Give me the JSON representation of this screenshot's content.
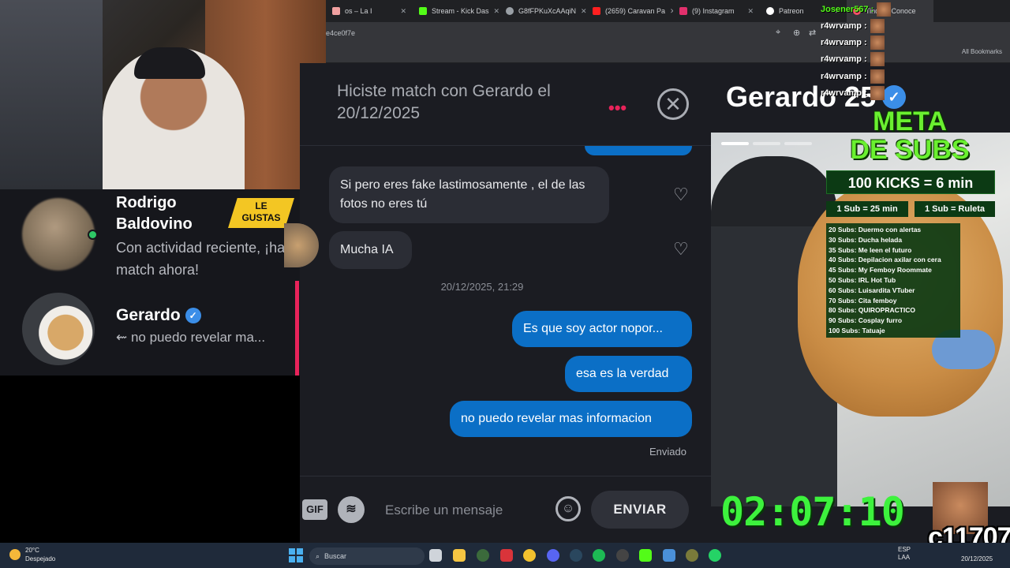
{
  "browser": {
    "tabs": [
      {
        "label": "os – La I",
        "color": "#f0a0a0",
        "active": false
      },
      {
        "label": "Stream - Kick Das",
        "color": "#53fc18",
        "active": false
      },
      {
        "label": "G8fFPKuXcAAqiN",
        "color": "#9aa0a6",
        "active": false
      },
      {
        "label": "(2659) Caravan Pa",
        "color": "#ff2020",
        "active": false
      },
      {
        "label": "(9) Instagram",
        "color": "#e1306c",
        "active": false
      },
      {
        "label": "Patreon",
        "color": "#ffffff",
        "active": false
      },
      {
        "label": "Tinder | Conoce",
        "color": "#fd5068",
        "active": true
      }
    ],
    "address": "e4ce0f7e",
    "all_bookmarks": "All Bookmarks"
  },
  "matches": {
    "rodrigo": {
      "name": "Rodrigo Baldovino",
      "badge": "LE GUSTAS",
      "subtitle": "Con actividad reciente, ¡haz match ahora!"
    },
    "gerardo": {
      "name": "Gerardo",
      "verified": "✓",
      "subtitle": "⇜ no puedo revelar ma..."
    }
  },
  "chat": {
    "title": "Hiciste match con Gerardo el 20/12/2025",
    "dots": "•••",
    "close": "✕",
    "messages": [
      {
        "dir": "in",
        "text": "Si pero eres fake lastimosamente , el de las fotos no eres tú"
      },
      {
        "dir": "in",
        "text": "Mucha IA"
      },
      {
        "dir": "out",
        "text": "Es que soy actor nopor..."
      },
      {
        "dir": "out",
        "text": "esa es la verdad"
      },
      {
        "dir": "out",
        "text": "no puedo revelar mas informacion"
      }
    ],
    "timestamp": "20/12/2025, 21:29",
    "status": "Enviado",
    "composer": {
      "gif": "GIF",
      "placeholder": "Escribe un mensaje",
      "send": "ENVIAR"
    }
  },
  "profile": {
    "name": "Gerardo 25",
    "verified": "✓"
  },
  "stream_overlay": {
    "meta_line1": "META",
    "meta_line2": "DE SUBS",
    "kicks": "100 KICKS = 6 min",
    "sub_a": "1 Sub = 25 min",
    "sub_b": "1 Sub = Ruleta",
    "goals": [
      "20 Subs: Duermo con alertas",
      "30 Subs: Ducha helada",
      "35 Subs: Me leen el futuro",
      "40 Subs: Depilacion axilar con cera",
      "45 Subs: My Femboy Roommate",
      "50 Subs: IRL Hot Tub",
      "60 Subs: Luisardita VTuber",
      "70 Subs: Cita femboy",
      "80 Subs: QUIROPRACTICO",
      "90 Subs: Cosplay furro",
      "100 Subs: Tatuaje"
    ],
    "timer": "02:07:10",
    "counter": "c11707",
    "chat_lines": [
      "Josener567 :",
      "r4wrvamp :",
      "r4wrvamp :",
      "r4wrvamp :",
      "r4wrvamp :",
      "r4wrvamp :"
    ]
  },
  "taskbar": {
    "weather_temp": "20°C",
    "weather_desc": "Despejado",
    "search": "Buscar",
    "lang": "ESP",
    "lang2": "LAA",
    "date": "20/12/2025"
  }
}
